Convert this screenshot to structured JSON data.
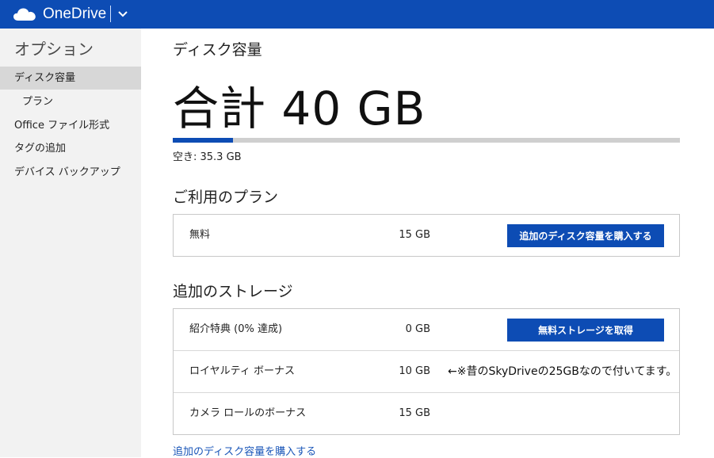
{
  "header": {
    "app_name": "OneDrive",
    "brand_color": "#0d4cb4"
  },
  "sidebar": {
    "title": "オプション",
    "items": [
      {
        "label": "ディスク容量",
        "active": true
      },
      {
        "label": "プラン",
        "active": false
      },
      {
        "label": "Office ファイル形式",
        "active": false
      },
      {
        "label": "タグの追加",
        "active": false
      },
      {
        "label": "デバイス バックアップ",
        "active": false
      }
    ]
  },
  "main": {
    "heading": "ディスク容量",
    "total": "合計 40 GB",
    "usage_fraction": 0.118,
    "free_label": "空き: 35.3 GB",
    "plan_section": {
      "heading": "ご利用のプラン",
      "rows": [
        {
          "name": "無料",
          "size": "15 GB",
          "button": "追加のディスク容量を購入する"
        }
      ]
    },
    "storage_section": {
      "heading": "追加のストレージ",
      "rows": [
        {
          "name": "紹介特典 (0% 達成)",
          "size": "0 GB",
          "button": "無料ストレージを取得"
        },
        {
          "name": "ロイヤルティ ボーナス",
          "size": "10 GB",
          "note": "←※昔のSkyDriveの25GBなので付いてます。"
        },
        {
          "name": "カメラ ロールのボーナス",
          "size": "15 GB"
        }
      ]
    },
    "buy_link": "追加のディスク容量を購入する"
  }
}
